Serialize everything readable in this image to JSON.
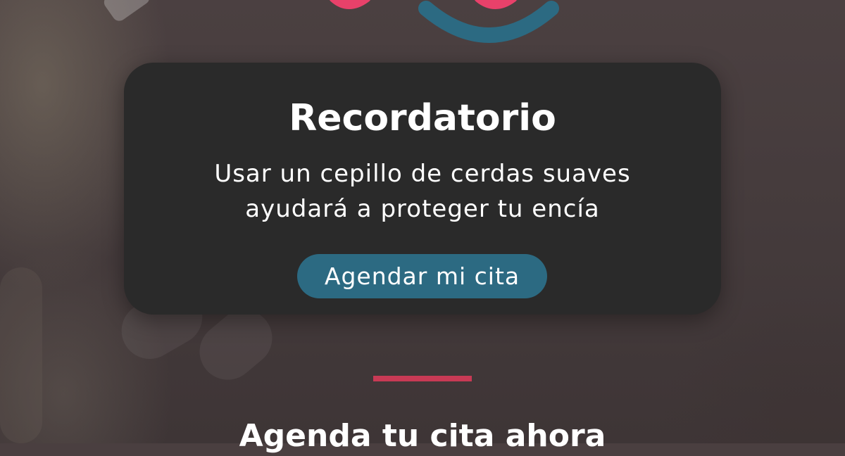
{
  "card": {
    "title": "Recordatorio",
    "text": "Usar un cepillo de cerdas suaves ayudará a proteger tu encía",
    "button_label": "Agendar mi cita"
  },
  "footer": {
    "heading": "Agenda tu cita ahora"
  },
  "colors": {
    "logo_pink": "#e8416a",
    "logo_blue": "#2c6a82",
    "button_bg": "#2c6a82",
    "divider": "#c83a55",
    "card_bg": "#2a2a2a"
  },
  "icons": {
    "logo": "smile-logo-icon"
  }
}
